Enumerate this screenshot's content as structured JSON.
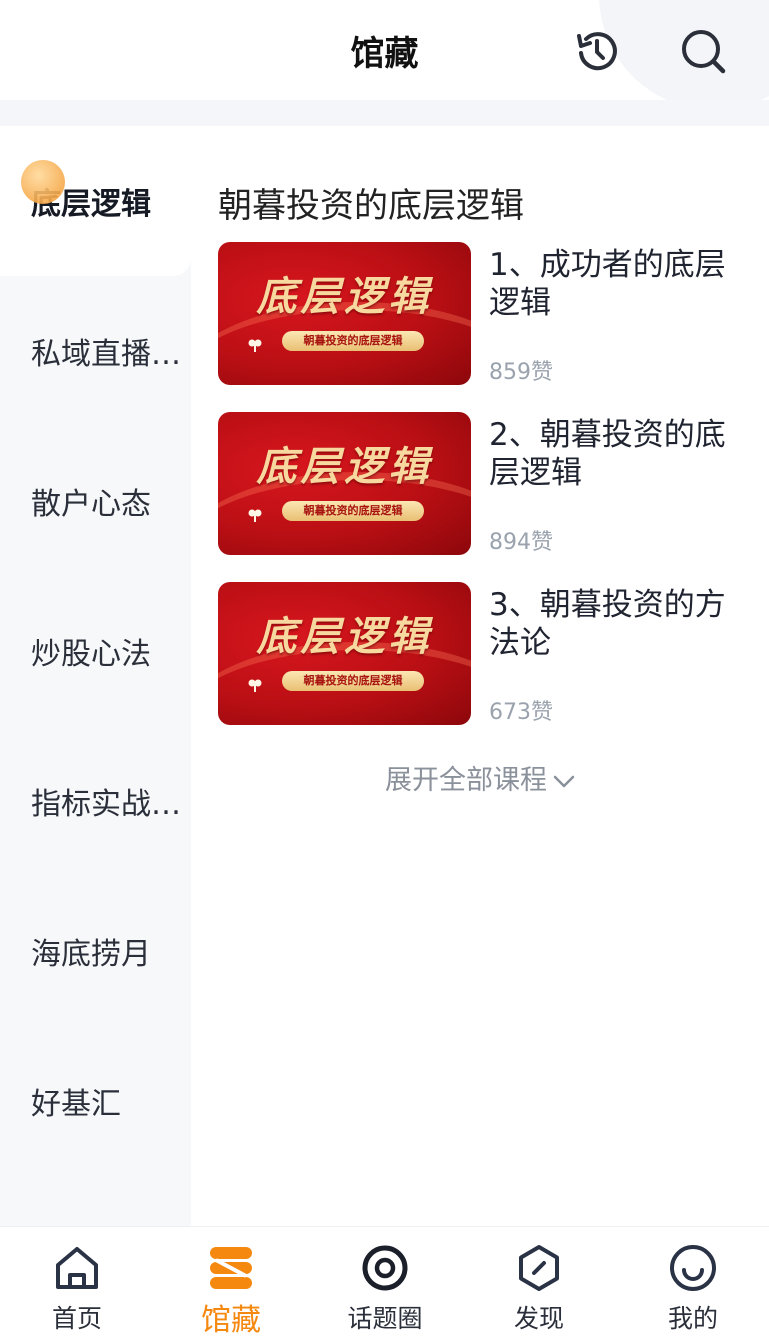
{
  "header": {
    "title": "馆藏",
    "icons": [
      "history-icon",
      "search-icon"
    ]
  },
  "sidebar": {
    "items": [
      {
        "label": "底层逻辑",
        "active": true
      },
      {
        "label": "私域直播…",
        "active": false
      },
      {
        "label": "散户心态",
        "active": false
      },
      {
        "label": "炒股心法",
        "active": false
      },
      {
        "label": "指标实战…",
        "active": false
      },
      {
        "label": "海底捞月",
        "active": false
      },
      {
        "label": "好基汇",
        "active": false
      }
    ]
  },
  "main": {
    "section_title": "朝暮投资的底层逻辑",
    "courses": [
      {
        "title": "1、成功者的底层逻辑",
        "likes": "859赞",
        "thumb_title": "底层逻辑",
        "thumb_subtitle": "朝暮投资的底层逻辑"
      },
      {
        "title": "2、朝暮投资的底层逻辑",
        "likes": "894赞",
        "thumb_title": "底层逻辑",
        "thumb_subtitle": "朝暮投资的底层逻辑"
      },
      {
        "title": "3、朝暮投资的方法论",
        "likes": "673赞",
        "thumb_title": "底层逻辑",
        "thumb_subtitle": "朝暮投资的底层逻辑"
      }
    ],
    "expand_label": "展开全部课程"
  },
  "bottom_nav": {
    "items": [
      {
        "label": "首页",
        "icon": "home-icon",
        "active": false
      },
      {
        "label": "馆藏",
        "icon": "collection-icon",
        "active": true
      },
      {
        "label": "话题圈",
        "icon": "topic-circle-icon",
        "active": false
      },
      {
        "label": "发现",
        "icon": "discover-icon",
        "active": false
      },
      {
        "label": "我的",
        "icon": "profile-icon",
        "active": false
      }
    ]
  },
  "colors": {
    "accent": "#f5880f",
    "text": "#222831",
    "muted": "#9aa2ad",
    "sidebar_bg": "#f7f8fa",
    "thumb_red": "#b90f14"
  }
}
